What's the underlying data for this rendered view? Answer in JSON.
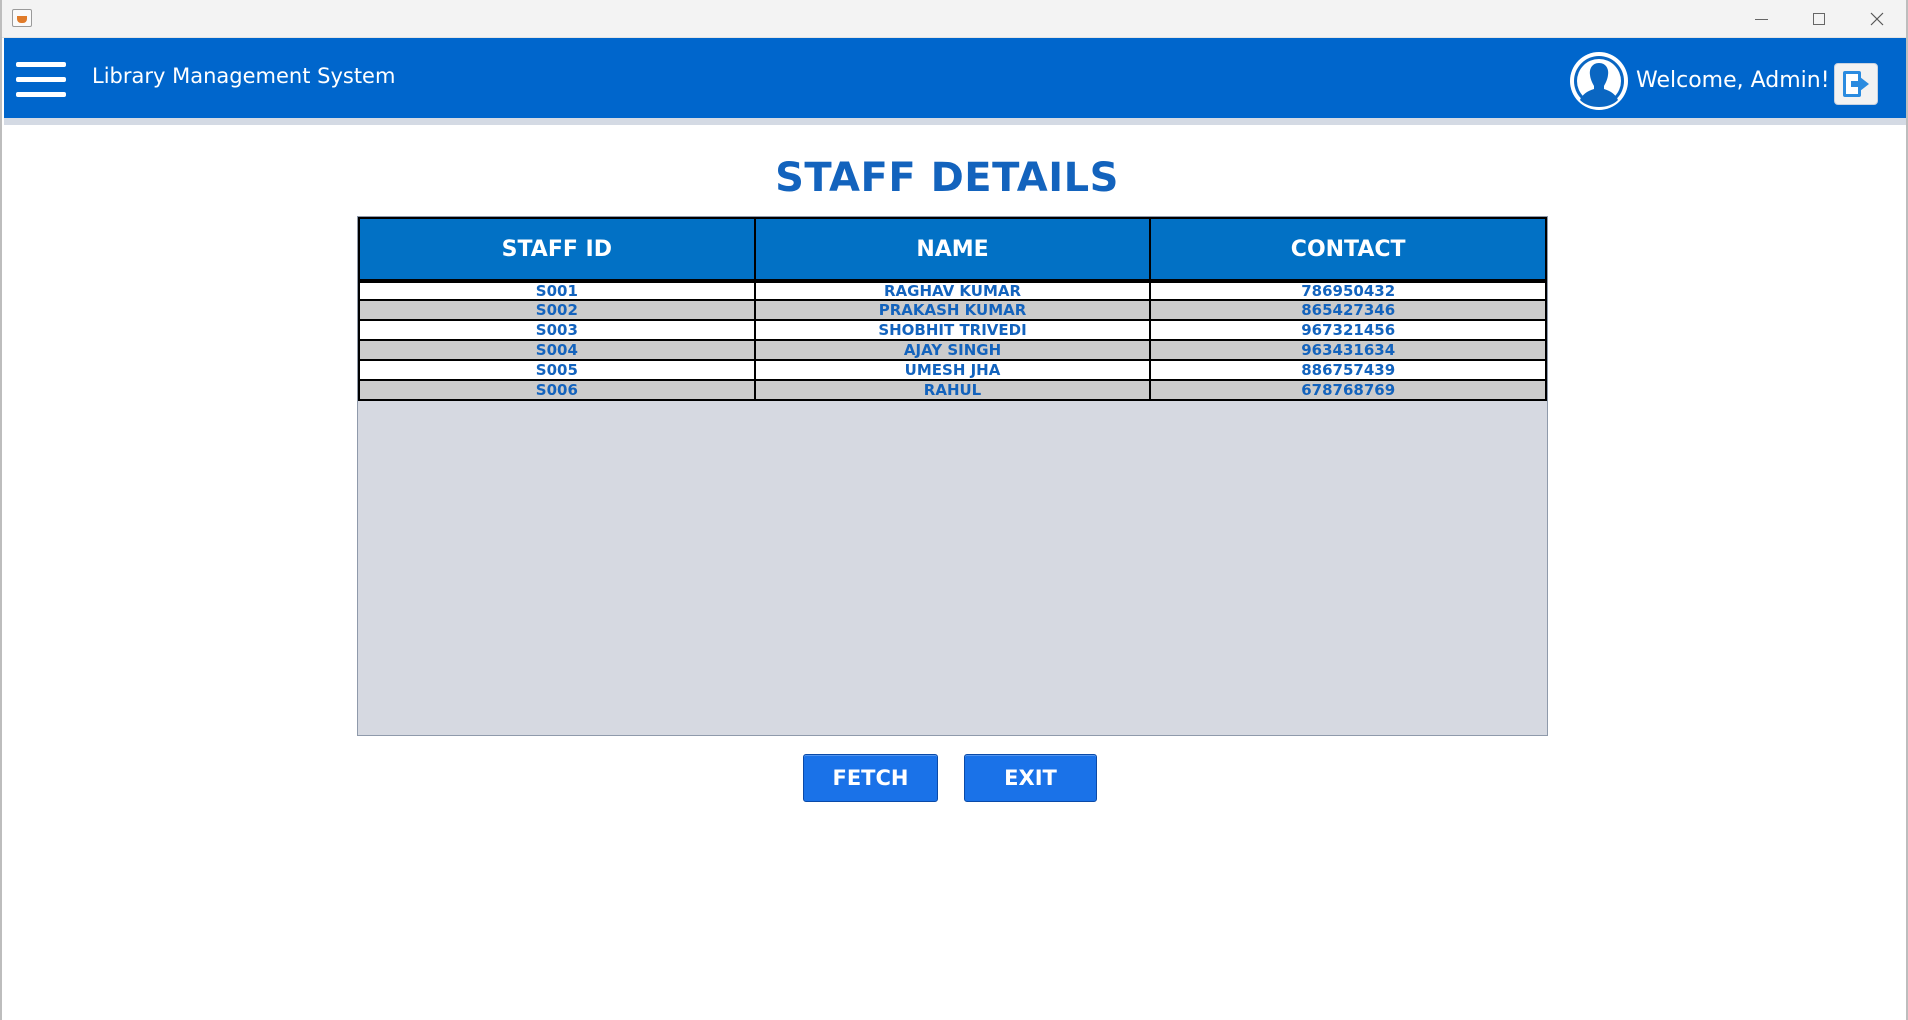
{
  "window": {
    "close_glyph": "✕"
  },
  "header": {
    "title": "Library Management System",
    "welcome": "Welcome, Admin!"
  },
  "page": {
    "title": "STAFF DETAILS"
  },
  "table": {
    "columns": [
      "STAFF ID",
      "NAME",
      "CONTACT"
    ],
    "rows": [
      [
        "S001",
        "RAGHAV KUMAR",
        "786950432"
      ],
      [
        "S002",
        "PRAKASH KUMAR",
        "865427346"
      ],
      [
        "S003",
        "SHOBHIT TRIVEDI",
        "967321456"
      ],
      [
        "S004",
        "AJAY SINGH",
        "963431634"
      ],
      [
        "S005",
        "UMESH JHA",
        "886757439"
      ],
      [
        "S006",
        "RAHUL",
        "678768769"
      ]
    ]
  },
  "buttons": {
    "fetch": "FETCH",
    "exit": "EXIT"
  },
  "colors": {
    "header_bg": "#0066cc",
    "title_color": "#1363bd",
    "button_bg": "#1a72e8"
  },
  "icons": {
    "menu": "hamburger-icon",
    "avatar": "user-avatar-icon",
    "logout": "logout-icon",
    "app": "java-app-icon"
  }
}
